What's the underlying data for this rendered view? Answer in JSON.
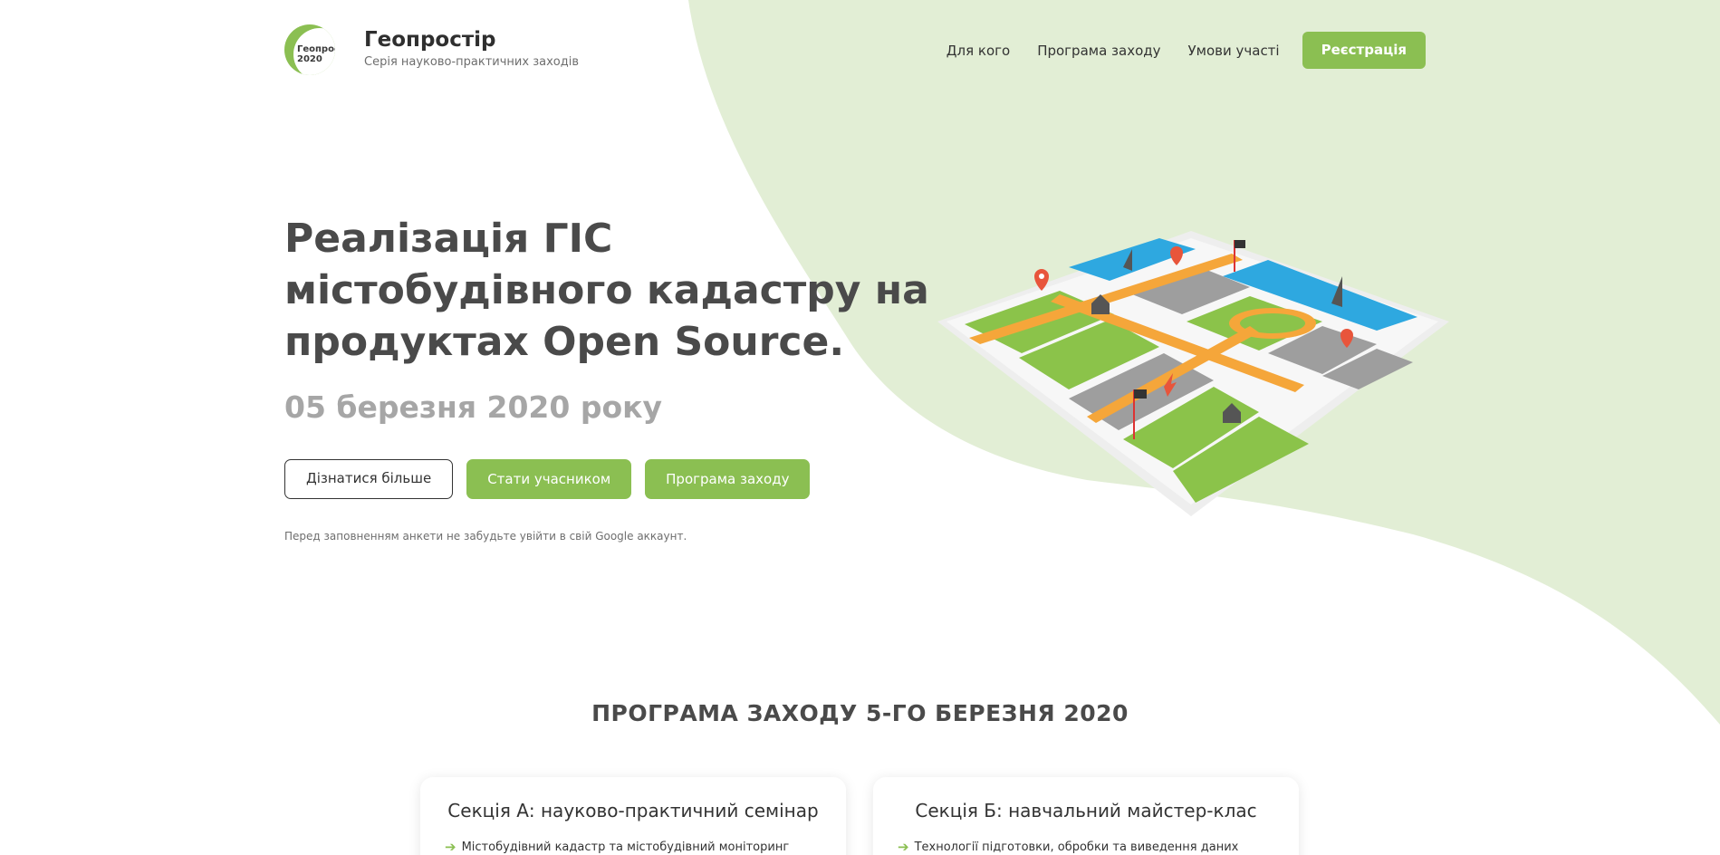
{
  "header": {
    "logo_line1": "Геопростір",
    "logo_line2": "2020",
    "brand_title": "Геопростір",
    "brand_subtitle": "Серія науково-практичних заходів",
    "nav": [
      "Для кого",
      "Програма заходу",
      "Умови участі"
    ],
    "register_label": "Реєстрація"
  },
  "hero": {
    "title": "Реалізація ГІС містобудівного кадастру на продуктах Open Source.",
    "date": "05 березня 2020 року",
    "buttons": [
      "Дізнатися більше",
      "Стати учасником",
      "Програма заходу"
    ],
    "note": "Перед заповненням анкети не забудьте увійти в свій Google аккаунт."
  },
  "program": {
    "title": "ПРОГРАМА ЗАХОДУ 5-ГО БЕРЕЗНЯ 2020",
    "sections": [
      {
        "title": "Секція А: науково-практичний семінар",
        "first_item": "Містобудівний кадастр та містобудівний моніторинг"
      },
      {
        "title": "Секція Б: навчальний майстер-клас",
        "first_item": "Технології підготовки, обробки та виведення даних"
      }
    ]
  },
  "colors": {
    "accent": "#8bbf52",
    "blob": "#e2eed5",
    "text": "#4a4a4a",
    "muted": "#a6a6a6"
  },
  "icons": [
    "logo-mark-icon",
    "city-map-illustration",
    "arrow-right-icon"
  ]
}
